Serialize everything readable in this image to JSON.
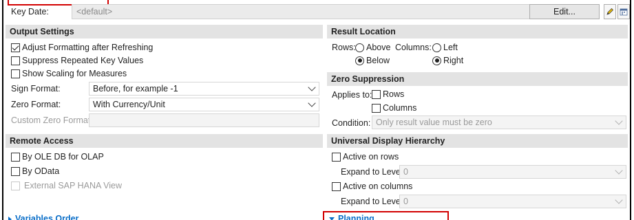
{
  "key_date": {
    "label": "Key Date:",
    "value": "<default>",
    "edit_label": "Edit..."
  },
  "output_settings": {
    "title": "Output Settings",
    "adjust_formatting": {
      "label": "Adjust Formatting after Refreshing",
      "checked": true
    },
    "suppress_repeated": {
      "label": "Suppress Repeated Key Values",
      "checked": false
    },
    "show_scaling": {
      "label": "Show Scaling for Measures",
      "checked": false
    },
    "sign_format": {
      "label": "Sign Format:",
      "value": "Before, for example -1"
    },
    "zero_format": {
      "label": "Zero Format:",
      "value": "With Currency/Unit"
    },
    "custom_zero_format": {
      "label": "Custom Zero Format:",
      "value": ""
    }
  },
  "result_location": {
    "title": "Result Location",
    "rows_label": "Rows:",
    "rows_above": "Above",
    "rows_below": "Below",
    "rows_selected": "Below",
    "columns_label": "Columns:",
    "columns_left": "Left",
    "columns_right": "Right",
    "columns_selected": "Right"
  },
  "zero_suppression": {
    "title": "Zero Suppression",
    "applies_to_label": "Applies to:",
    "rows": "Rows",
    "columns": "Columns",
    "condition_label": "Condition:",
    "condition_value": "Only result value must be zero"
  },
  "remote_access": {
    "title": "Remote Access",
    "ole_db": "By OLE DB for OLAP",
    "odata": "By OData",
    "hana_view": "External SAP HANA View"
  },
  "universal_display_hierarchy": {
    "title": "Universal Display Hierarchy",
    "active_on_rows": "Active on rows",
    "expand_rows_label": "Expand to Level:",
    "expand_rows_value": "0",
    "active_on_columns": "Active on columns",
    "expand_columns_label": "Expand to Level:",
    "expand_columns_value": "0"
  },
  "collapsibles": {
    "variables_order": "Variables Order",
    "planning": "Planning"
  },
  "icons": {
    "pencil": "pencil-icon",
    "calendar": "calendar-icon"
  },
  "colors": {
    "section_header": "#e3e3e3",
    "link": "#0a6ec8",
    "highlight": "#d20000"
  }
}
